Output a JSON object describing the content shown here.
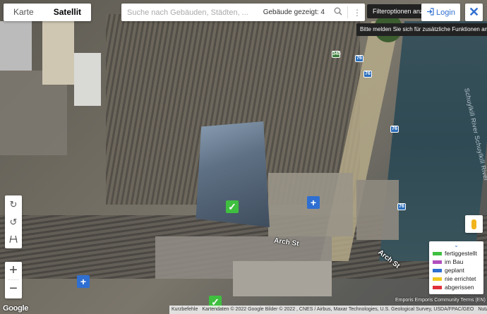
{
  "map_type": {
    "map_label": "Karte",
    "satellite_label": "Satellit",
    "active": "satellite"
  },
  "search": {
    "placeholder": "Suche nach Gebäuden, Städten, ...",
    "buildings_shown": "Gebäude gezeigt: 4"
  },
  "filter_tooltip": "Filteroptionen anzeigen",
  "login": {
    "label": "Login",
    "tooltip": "Bitte melden Sie sich für zusätzliche Funktionen an!"
  },
  "labels": {
    "street1": "Arch St",
    "street2": "Arch St",
    "river": "Schuylkill River Schuylkill River",
    "shields": [
      "345",
      "76",
      "76",
      "76",
      "76"
    ]
  },
  "legend": [
    {
      "label": "fertiggestellt",
      "color": "#3fbf3f"
    },
    {
      "label": "im Bau",
      "color": "#b24fbf"
    },
    {
      "label": "geplant",
      "color": "#2f6fd1"
    },
    {
      "label": "nie errichtet",
      "color": "#f2c81d"
    },
    {
      "label": "abgerissen",
      "color": "#e0303a"
    }
  ],
  "footer": {
    "shortcuts": "Kurzbefehle",
    "attribution": "Kartendaten © 2022 Google Bilder © 2022 , CNES / Airbus, Maxar Technologies, U.S. Geological Survey, USDA/FPAC/GEO",
    "terms": "Nutzungsbedingungen",
    "google": "Google",
    "emporis": "Emporis Emporis Community Terms (EN)"
  },
  "colors": {
    "accent": "#2f6fd1"
  }
}
